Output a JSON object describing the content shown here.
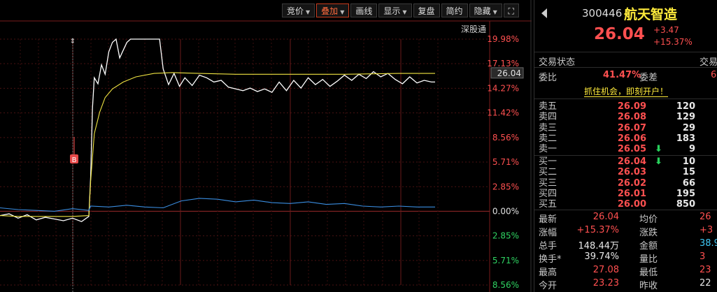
{
  "toolbar": {
    "buttons": [
      {
        "label": "竞价",
        "caret": true,
        "active": false
      },
      {
        "label": "叠加",
        "caret": true,
        "active": true
      },
      {
        "label": "画线",
        "caret": false,
        "active": false
      },
      {
        "label": "显示",
        "caret": true,
        "active": false
      },
      {
        "label": "复盘",
        "caret": false,
        "active": false
      },
      {
        "label": "简约",
        "caret": false,
        "active": false
      },
      {
        "label": "隐藏",
        "caret": true,
        "active": false
      }
    ],
    "fullscreen_icon": "⛶"
  },
  "chart": {
    "board_label": "深股通",
    "current_price_tag": "26.04",
    "buy_marker": "B",
    "pct_labels": [
      {
        "text": "19.98%",
        "color": "#ff5050"
      },
      {
        "text": "17.13%",
        "color": "#ff5050"
      },
      {
        "text": "14.27%",
        "color": "#ff5050"
      },
      {
        "text": "11.42%",
        "color": "#ff5050"
      },
      {
        "text": "8.56%",
        "color": "#ff5050"
      },
      {
        "text": "5.71%",
        "color": "#ff5050"
      },
      {
        "text": "2.85%",
        "color": "#ff5050"
      },
      {
        "text": "0.00%",
        "color": "#e0e0e0"
      },
      {
        "text": "2.85%",
        "color": "#2fd462"
      },
      {
        "text": "5.71%",
        "color": "#2fd462"
      },
      {
        "text": "8.56%",
        "color": "#2fd462"
      }
    ],
    "colors": {
      "price_line": "#ffffff",
      "avg_line": "#f0e442",
      "overlay_line": "#3a8de0",
      "grid": "#5a1414"
    }
  },
  "chart_data": {
    "type": "line",
    "ylim_pct": [
      -8.56,
      19.98
    ],
    "x_minutes_total": 240,
    "series": [
      {
        "points_pct": [
          [
            0,
            -0.5
          ],
          [
            5,
            -0.3
          ],
          [
            10,
            -0.8
          ],
          [
            15,
            -0.4
          ],
          [
            20,
            -1.0
          ],
          [
            25,
            -0.7
          ],
          [
            30,
            -0.9
          ],
          [
            35,
            -1.1
          ],
          [
            40,
            -0.8
          ],
          [
            45,
            -1.2
          ],
          [
            49,
            -0.6
          ],
          [
            50,
            4.0
          ],
          [
            51,
            12.0
          ],
          [
            52,
            15.5
          ],
          [
            54,
            14.8
          ],
          [
            56,
            17.0
          ],
          [
            58,
            15.9
          ],
          [
            60,
            18.5
          ],
          [
            62,
            19.6
          ],
          [
            64,
            19.98
          ],
          [
            66,
            17.8
          ],
          [
            68,
            18.7
          ],
          [
            70,
            19.6
          ],
          [
            72,
            19.98
          ],
          [
            80,
            19.98
          ],
          [
            88,
            19.98
          ],
          [
            90,
            16.5
          ],
          [
            93,
            14.7
          ],
          [
            96,
            16.0
          ],
          [
            99,
            14.5
          ],
          [
            102,
            15.5
          ],
          [
            106,
            14.6
          ],
          [
            110,
            15.8
          ],
          [
            114,
            15.5
          ],
          [
            118,
            15.0
          ],
          [
            122,
            15.2
          ],
          [
            126,
            14.4
          ],
          [
            130,
            14.2
          ],
          [
            134,
            14.0
          ],
          [
            138,
            14.3
          ],
          [
            142,
            13.9
          ],
          [
            146,
            14.2
          ],
          [
            150,
            13.8
          ],
          [
            154,
            15.0
          ],
          [
            158,
            14.0
          ],
          [
            162,
            15.2
          ],
          [
            166,
            14.3
          ],
          [
            170,
            15.5
          ],
          [
            174,
            14.7
          ],
          [
            178,
            15.3
          ],
          [
            182,
            14.5
          ],
          [
            186,
            15.1
          ],
          [
            190,
            15.8
          ],
          [
            194,
            15.2
          ],
          [
            198,
            15.9
          ],
          [
            202,
            15.4
          ],
          [
            206,
            16.2
          ],
          [
            210,
            15.6
          ],
          [
            214,
            16.0
          ],
          [
            218,
            15.3
          ],
          [
            222,
            14.8
          ],
          [
            226,
            15.6
          ],
          [
            230,
            14.9
          ],
          [
            234,
            15.2
          ],
          [
            238,
            15.0
          ],
          [
            240,
            15.0
          ]
        ]
      },
      {
        "points_pct": [
          [
            0,
            -0.5
          ],
          [
            10,
            -0.6
          ],
          [
            20,
            -0.6
          ],
          [
            30,
            -0.6
          ],
          [
            40,
            -0.6
          ],
          [
            49,
            -0.5
          ],
          [
            50,
            3.5
          ],
          [
            52,
            9.0
          ],
          [
            55,
            11.5
          ],
          [
            58,
            13.2
          ],
          [
            62,
            14.2
          ],
          [
            68,
            15.0
          ],
          [
            75,
            15.6
          ],
          [
            85,
            16.0
          ],
          [
            95,
            16.1
          ],
          [
            110,
            16.0
          ],
          [
            130,
            15.9
          ],
          [
            160,
            15.9
          ],
          [
            190,
            15.9
          ],
          [
            220,
            16.0
          ],
          [
            240,
            16.0
          ]
        ]
      },
      {
        "points_pct": [
          [
            0,
            0.4
          ],
          [
            10,
            0.2
          ],
          [
            20,
            0.1
          ],
          [
            30,
            0.0
          ],
          [
            40,
            0.3
          ],
          [
            49,
            0.1
          ],
          [
            50,
            0.6
          ],
          [
            60,
            0.5
          ],
          [
            70,
            0.7
          ],
          [
            80,
            0.5
          ],
          [
            90,
            0.4
          ],
          [
            100,
            1.2
          ],
          [
            110,
            1.5
          ],
          [
            120,
            1.4
          ],
          [
            130,
            1.1
          ],
          [
            140,
            1.3
          ],
          [
            150,
            1.0
          ],
          [
            160,
            0.9
          ],
          [
            170,
            1.1
          ],
          [
            180,
            0.8
          ],
          [
            190,
            0.9
          ],
          [
            200,
            0.6
          ],
          [
            210,
            0.5
          ],
          [
            220,
            0.6
          ],
          [
            230,
            0.5
          ],
          [
            240,
            0.5
          ]
        ]
      }
    ]
  },
  "quote": {
    "code": "300446",
    "name": "航天智造",
    "price": "26.04",
    "change": "+3.47",
    "change_pct": "+15.37%",
    "status_label": "交易状态",
    "status_right": "交易",
    "weibi_label": "委比",
    "weibi_value": "41.47%",
    "weicha_label": "委差",
    "weicha_value": "6",
    "promo": "抓住机会，即刻开户！",
    "asks": [
      {
        "name": "卖五",
        "price": "26.09",
        "vol": "120",
        "arrow": ""
      },
      {
        "name": "卖四",
        "price": "26.08",
        "vol": "129",
        "arrow": ""
      },
      {
        "name": "卖三",
        "price": "26.07",
        "vol": "29",
        "arrow": ""
      },
      {
        "name": "卖二",
        "price": "26.06",
        "vol": "183",
        "arrow": ""
      },
      {
        "name": "卖一",
        "price": "26.05",
        "vol": "9",
        "arrow": "⬇"
      }
    ],
    "bids": [
      {
        "name": "买一",
        "price": "26.04",
        "vol": "10",
        "arrow": "⬇"
      },
      {
        "name": "买二",
        "price": "26.03",
        "vol": "15",
        "arrow": ""
      },
      {
        "name": "买三",
        "price": "26.02",
        "vol": "66",
        "arrow": ""
      },
      {
        "name": "买四",
        "price": "26.01",
        "vol": "195",
        "arrow": ""
      },
      {
        "name": "买五",
        "price": "26.00",
        "vol": "850",
        "arrow": ""
      }
    ],
    "stats": [
      {
        "l1": "最新",
        "v1": "26.04",
        "c1": "red",
        "l2": "均价",
        "v2": "26",
        "c2": "red"
      },
      {
        "l1": "涨幅",
        "v1": "+15.37%",
        "c1": "red",
        "l2": "涨跌",
        "v2": "+3",
        "c2": "red"
      },
      {
        "l1": "总手",
        "v1": "148.44万",
        "c1": "white",
        "l2": "金额",
        "v2": "38.9",
        "c2": "cyan"
      },
      {
        "l1": "换手*",
        "v1": "39.74%",
        "c1": "white",
        "l2": "量比",
        "v2": "3",
        "c2": "red"
      },
      {
        "l1": "最高",
        "v1": "27.08",
        "c1": "red",
        "l2": "最低",
        "v2": "23",
        "c2": "red"
      },
      {
        "l1": "今开",
        "v1": "23.23",
        "c1": "red",
        "l2": "昨收",
        "v2": "22",
        "c2": "white"
      }
    ]
  }
}
